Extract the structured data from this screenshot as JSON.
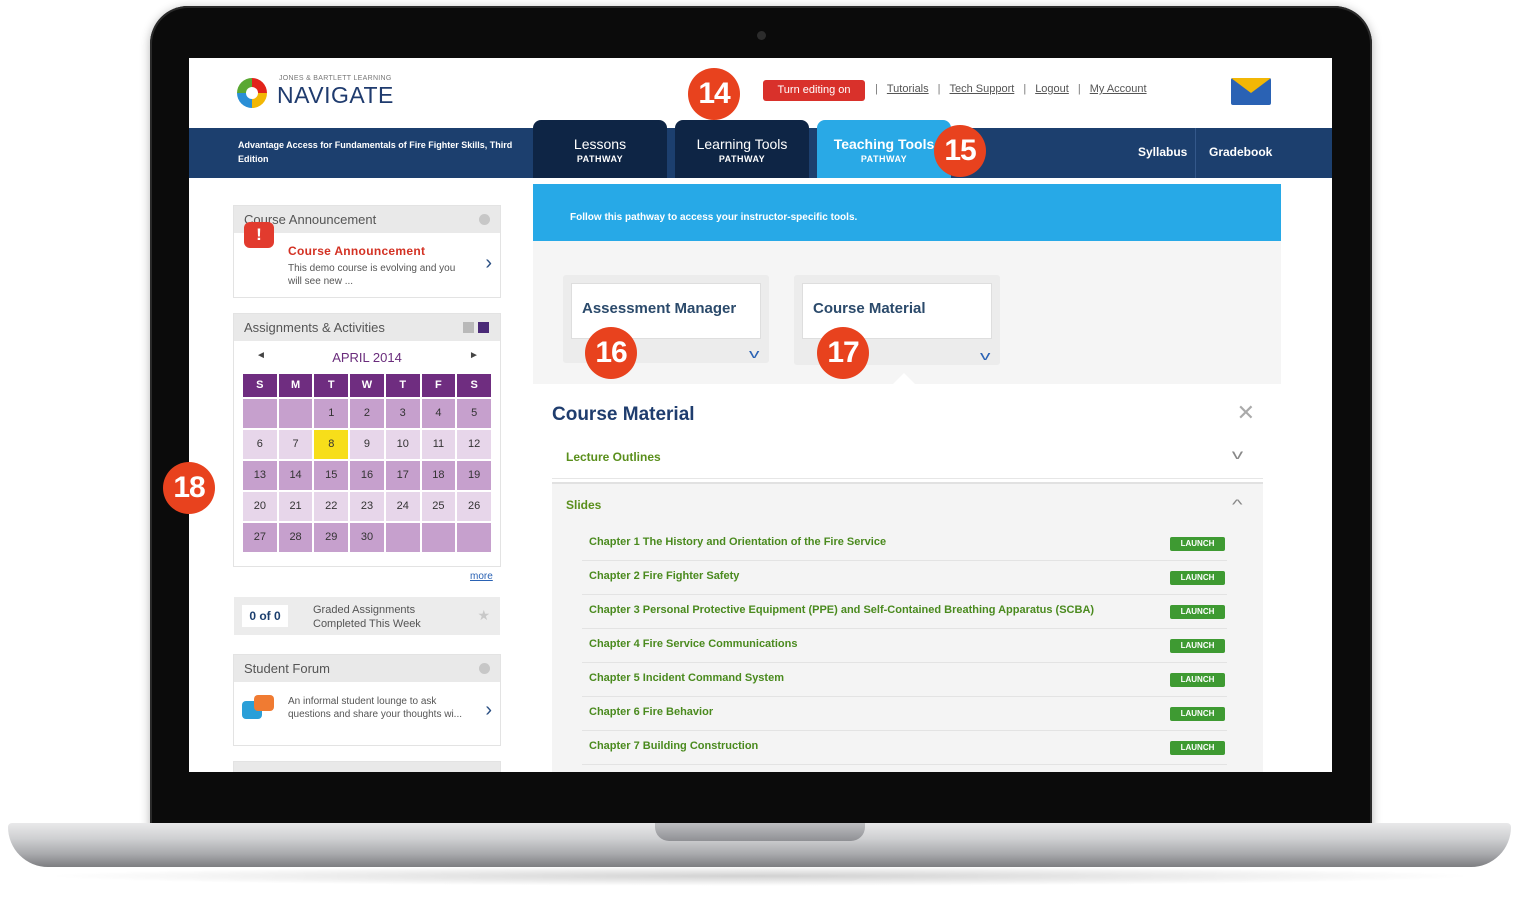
{
  "header": {
    "logo_small": "JONES & BARTLETT LEARNING",
    "logo_big": "NAVIGATE",
    "edit_button": "Turn editing on",
    "links": [
      "Tutorials",
      "Tech Support",
      "Logout",
      "My Account"
    ]
  },
  "nav": {
    "course_title": "Advantage Access for Fundamentals of Fire Fighter Skills, Third Edition",
    "tabs": [
      {
        "label": "Lessons",
        "sub": "PATHWAY"
      },
      {
        "label": "Learning Tools",
        "sub": "PATHWAY"
      },
      {
        "label": "Teaching Tools",
        "sub": "PATHWAY"
      }
    ],
    "syllabus": "Syllabus",
    "gradebook": "Gradebook"
  },
  "sidebar": {
    "announcement": {
      "header": "Course Announcement",
      "title": "Course Announcement",
      "text": "This demo course is evolving and you will see new ..."
    },
    "assignments": {
      "header": "Assignments & Activities",
      "prev": "◄",
      "next": "►",
      "month": "APRIL 2014",
      "weekdays": [
        "S",
        "M",
        "T",
        "W",
        "T",
        "F",
        "S"
      ],
      "weeks": [
        [
          "",
          "",
          "1",
          "2",
          "3",
          "4",
          "5"
        ],
        [
          "6",
          "7",
          "8",
          "9",
          "10",
          "11",
          "12"
        ],
        [
          "13",
          "14",
          "15",
          "16",
          "17",
          "18",
          "19"
        ],
        [
          "20",
          "21",
          "22",
          "23",
          "24",
          "25",
          "26"
        ],
        [
          "27",
          "28",
          "29",
          "30",
          "",
          "",
          ""
        ]
      ],
      "today": "8",
      "more": "more"
    },
    "graded": {
      "count": "0 of 0",
      "text": "Graded Assignments Completed This Week"
    },
    "forum": {
      "header": "Student Forum",
      "text": "An informal student lounge to ask questions and share your thoughts wi..."
    }
  },
  "main": {
    "banner": "Follow this pathway to access your instructor-specific tools.",
    "cards": [
      "Assessment Manager",
      "Course Material"
    ],
    "panel_title": "Course Material",
    "accordion": [
      {
        "label": "Lecture Outlines"
      },
      {
        "label": "Slides"
      }
    ],
    "launch_label": "LAUNCH",
    "chapters": [
      "Chapter 1 The History and Orientation of the Fire Service",
      "Chapter 2 Fire Fighter Safety",
      "Chapter 3 Personal Protective Equipment (PPE) and Self-Contained Breathing Apparatus (SCBA)",
      "Chapter 4 Fire Service Communications",
      "Chapter 5 Incident Command System",
      "Chapter 6 Fire Behavior",
      "Chapter 7 Building Construction"
    ]
  },
  "callouts": [
    "14",
    "15",
    "16",
    "17",
    "18"
  ],
  "colors": {
    "navbar": "#1c3f6e",
    "accent_blue": "#27a9e7",
    "calendar_purple": "#6f2d80",
    "callout_orange": "#e8421e",
    "launch_green": "#3e9a32"
  }
}
